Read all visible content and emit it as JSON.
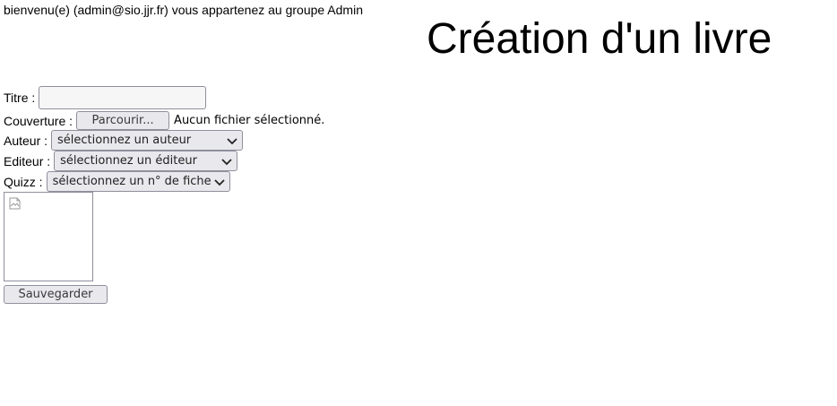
{
  "header": {
    "welcome_text": "bienvenu(e) (admin@sio.jjr.fr) vous appartenez au groupe Admin",
    "page_title": "Création d'un livre"
  },
  "form": {
    "titre": {
      "label": "Titre :",
      "value": ""
    },
    "couverture": {
      "label": "Couverture :",
      "button_label": "Parcourir...",
      "status": "Aucun fichier sélectionné."
    },
    "auteur": {
      "label": "Auteur :",
      "selected": "sélectionnez un auteur"
    },
    "editeur": {
      "label": "Editeur :",
      "selected": "sélectionnez un éditeur"
    },
    "quizz": {
      "label": "Quizz :",
      "selected": "sélectionnez un n° de fiche"
    },
    "cover_preview_icon": "broken-image-icon",
    "save_label": "Sauvegarder"
  },
  "colors": {
    "control_bg": "#e9e9ed",
    "control_border": "#8f8f9d",
    "input_bg": "#f6f6f6"
  }
}
